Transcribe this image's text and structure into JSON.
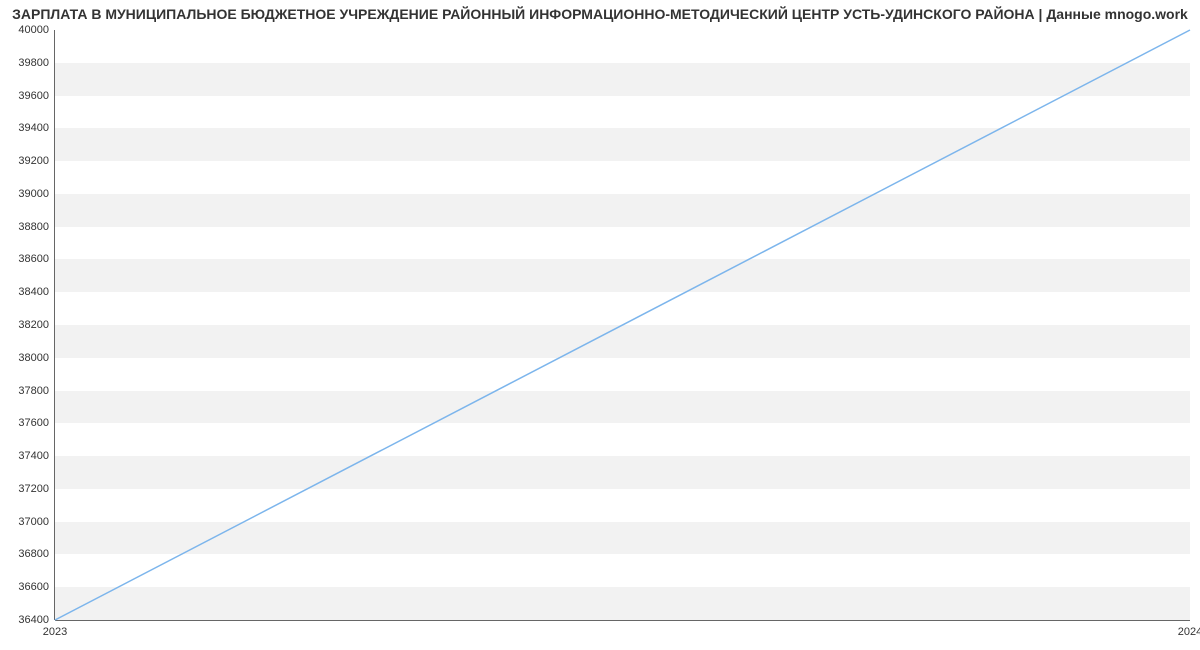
{
  "chart_data": {
    "type": "line",
    "title": "ЗАРПЛАТА В МУНИЦИПАЛЬНОЕ БЮДЖЕТНОЕ УЧРЕЖДЕНИЕ РАЙОННЫЙ ИНФОРМАЦИОННО-МЕТОДИЧЕСКИЙ ЦЕНТР УСТЬ-УДИНСКОГО РАЙОНА | Данные mnogo.work",
    "x": [
      2023,
      2024
    ],
    "values": [
      36400,
      40000
    ],
    "x_ticks": [
      2023,
      2024
    ],
    "y_ticks": [
      36400,
      36600,
      36800,
      37000,
      37200,
      37400,
      37600,
      37800,
      38000,
      38200,
      38400,
      38600,
      38800,
      39000,
      39200,
      39400,
      39600,
      39800,
      40000
    ],
    "xlim": [
      2023,
      2024
    ],
    "ylim": [
      36400,
      40000
    ],
    "line_color": "#7cb5ec",
    "grid_alternating": true
  }
}
